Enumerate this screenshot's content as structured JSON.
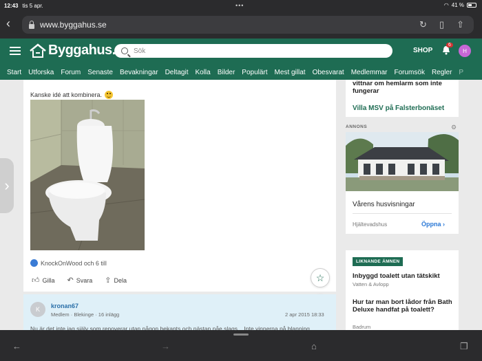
{
  "status_bar": {
    "time": "12:43",
    "date": "tis 5 apr.",
    "dots": "•••",
    "battery_percent": "41 %"
  },
  "browser": {
    "url": "www.byggahus.se"
  },
  "site_header": {
    "logo_text": "Byggahus.se",
    "search_placeholder": "Sök",
    "shop_label": "SHOP",
    "notification_count": "6",
    "avatar_initial": "H"
  },
  "nav": {
    "items": [
      "Start",
      "Utforska",
      "Forum",
      "Senaste",
      "Bevakningar",
      "Deltagit",
      "Kolla",
      "Bilder",
      "Populärt",
      "Mest gillat",
      "Obesvarat",
      "Medlemmar",
      "Forumsök",
      "Regler",
      "P"
    ]
  },
  "post": {
    "text": "Kanske idé att kombinera.",
    "likes_text": "KnockOnWood och 6 till",
    "actions": {
      "like": "Gilla",
      "reply": "Svara",
      "share": "Dela"
    }
  },
  "reply": {
    "avatar_initial": "K",
    "author": "kronan67",
    "meta": "Medlem · Blekinge · 16 inlägg",
    "date": "2 apr 2015 18:33",
    "snippet": "Nu är det inte jag själv som renoverar utan någon bekants och nästan nåe slags... Inte vinnerna på blanning"
  },
  "sidebar": {
    "top_link": "vittnar om hemlarm som inte fungerar",
    "villa_link": "Villa MSV på Falsterbonäset",
    "ad": {
      "label": "ANNONS",
      "title": "Vårens husvisningar",
      "brand": "Hjältevadshus",
      "open": "Öppna"
    },
    "related": {
      "heading": "LIKNANDE ÄMNEN",
      "items": [
        {
          "title": "Inbyggd toalett utan tätskikt",
          "sub": "Vatten & Avlopp"
        },
        {
          "title": "Hur tar man bort lådor från Bath Deluxe handfat på toalett?",
          "sub": "Badrum"
        }
      ]
    }
  },
  "colors": {
    "brand_green": "#1e6c53",
    "link_blue": "#2a6fa8",
    "reply_bg": "#dff0f8",
    "badge_red": "#d43232"
  }
}
